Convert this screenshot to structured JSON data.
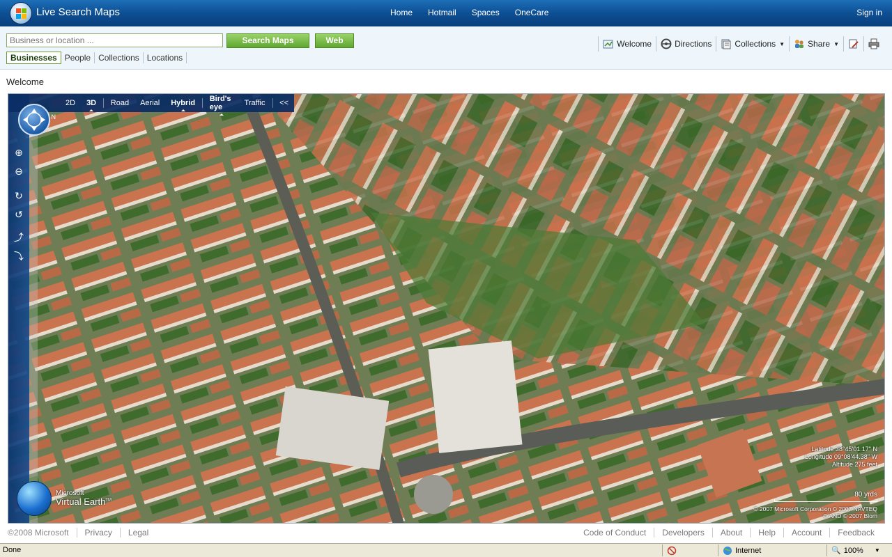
{
  "app": {
    "title": "Live Search Maps",
    "topnav": [
      "Home",
      "Hotmail",
      "Spaces",
      "OneCare"
    ],
    "signin": "Sign in"
  },
  "search": {
    "placeholder": "Business or location ...",
    "search_button": "Search Maps",
    "web_button": "Web",
    "tabs": [
      "Businesses",
      "People",
      "Collections",
      "Locations"
    ],
    "active_tab": "Businesses"
  },
  "toolbar": {
    "welcome": "Welcome",
    "directions": "Directions",
    "collections": "Collections",
    "share": "Share"
  },
  "page_title": "Welcome",
  "map": {
    "modes": [
      "2D",
      "3D",
      "Road",
      "Aerial",
      "Hybrid",
      "Bird's eye",
      "Traffic"
    ],
    "selected_modes": [
      "3D",
      "Hybrid",
      "Bird's eye"
    ],
    "collapse": "<<",
    "compass_n": "N",
    "ve_line1": "Microsoft",
    "ve_line2": "Virtual Earth",
    "ve_tm": "TM",
    "latitude": "Latitude 38°45'01.17\" N",
    "longitude": "Longitude 09°08'44.38\" W",
    "altitude": "Altitude 275 feet",
    "scale": "80 yrds",
    "copyright1": "© 2007 Microsoft Corporation  © 2007 NAVTEQ",
    "copyright2": "© AND  © 2007 Blom"
  },
  "footer": {
    "copyright": "©2008 Microsoft",
    "left_links": [
      "Privacy",
      "Legal"
    ],
    "right_links": [
      "Code of Conduct",
      "Developers",
      "About",
      "Help",
      "Account",
      "Feedback"
    ]
  },
  "statusbar": {
    "status": "Done",
    "zone": "Internet",
    "zoom": "100%"
  }
}
